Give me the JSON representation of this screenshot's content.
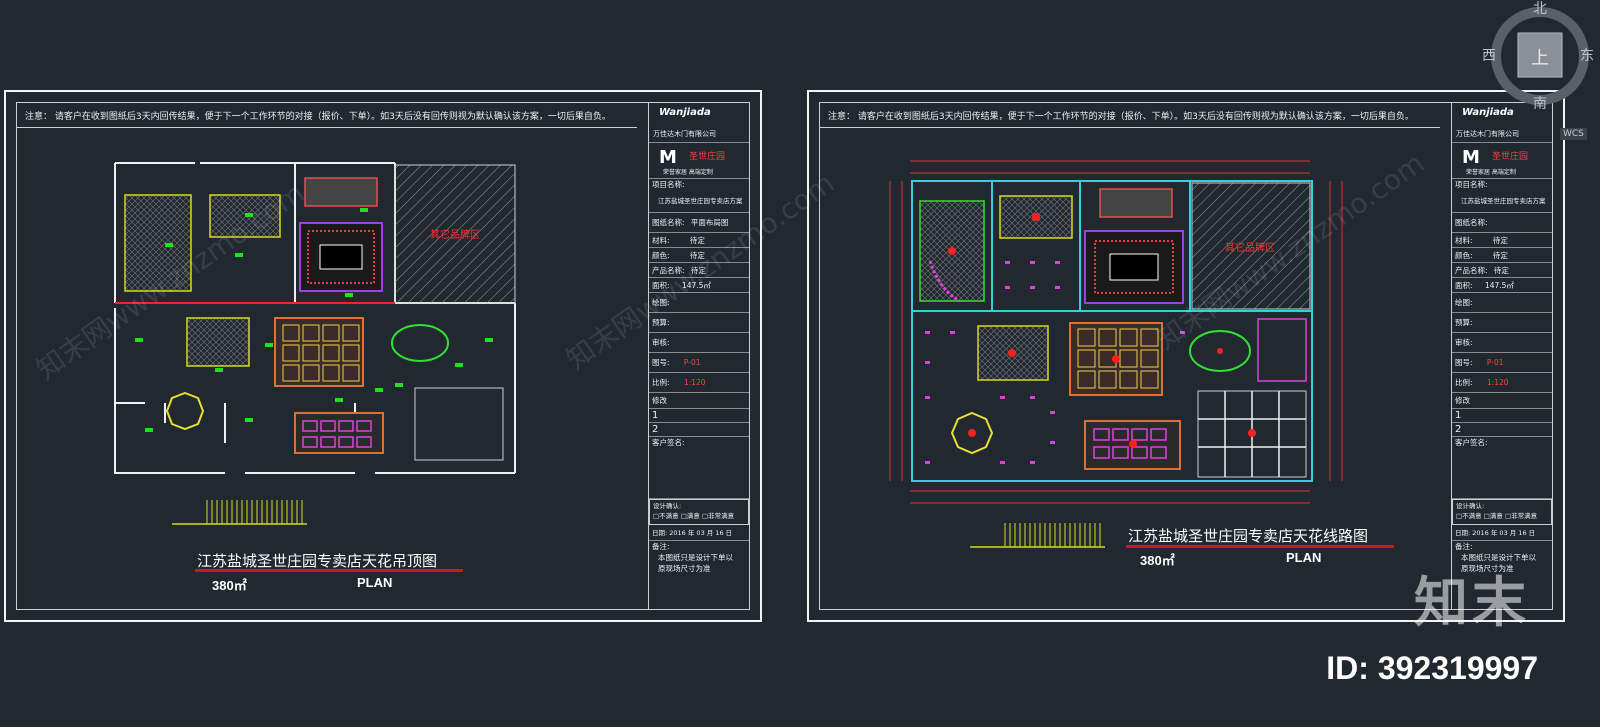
{
  "sheets": [
    {
      "note": "注意：  请客户在收到图纸后3天内回传结果，便于下一个工作环节的对接（报价、下单）。如3天后没有回传则视为默认确认该方案，一切后果自负。",
      "title": "江苏盐城圣世庄园专卖店天花吊顶图",
      "scale": "380㎡",
      "plan": "PLAN",
      "room_label": "其它品牌区",
      "titleblock": {
        "company": "万佳达木门有限公司",
        "brand_cn": "圣世庄园",
        "slogan": "荣誉家居  高端定制",
        "project_name_label": "项目名称:",
        "project_name": "江苏盐城圣世庄园专卖店方案",
        "drawing_name_label": "图纸名称:",
        "drawing_name": "平面布局图",
        "material_label": "材料:",
        "material": "待定",
        "color_label": "颜色:",
        "color": "待定",
        "product_label": "产品名称:",
        "product": "待定",
        "area_label": "面积:",
        "area": "147.5㎡",
        "draw_label": "绘图:",
        "budget_label": "预算:",
        "review_label": "审核:",
        "number_label": "图号:",
        "number": "P-01",
        "ratio_label": "比例:",
        "ratio": "1:120",
        "revise_label": "修改",
        "rev1": "1",
        "rev2": "2",
        "signature_label": "客户签名:",
        "design_conf_label": "设计确认:",
        "opt1": "□不满意",
        "opt2": "□满意",
        "opt3": "□非常满意",
        "date": "日期: 2016 年 03 月 16  日",
        "remark_label": "备注:",
        "remark": "本图纸只是设计下单以原现场尺寸为准"
      }
    },
    {
      "note": "注意：  请客户在收到图纸后3天内回传结果，便于下一个工作环节的对接（报价、下单）。如3天后没有回传则视为默认确认该方案，一切后果自负。",
      "title": "江苏盐城圣世庄园专卖店天花线路图",
      "scale": "380㎡",
      "plan": "PLAN",
      "room_label": "其它品牌区",
      "titleblock": {
        "company": "万佳达木门有限公司",
        "brand_cn": "圣世庄园",
        "slogan": "荣誉家居  高端定制",
        "project_name_label": "项目名称:",
        "project_name": "江苏盐城圣世庄园专卖店方案",
        "drawing_name_label": "图纸名称:",
        "drawing_name": "",
        "material_label": "材料:",
        "material": "待定",
        "color_label": "颜色:",
        "color": "待定",
        "product_label": "产品名称:",
        "product": "待定",
        "area_label": "面积:",
        "area": "147.5㎡",
        "draw_label": "绘图:",
        "budget_label": "预算:",
        "review_label": "审核:",
        "number_label": "图号:",
        "number": "P-01",
        "ratio_label": "比例:",
        "ratio": "1:120",
        "revise_label": "修改",
        "rev1": "1",
        "rev2": "2",
        "signature_label": "客户签名:",
        "design_conf_label": "设计确认:",
        "opt1": "□不满意",
        "opt2": "□满意",
        "opt3": "□非常满意",
        "date": "日期: 2016 年 03 月 16  日",
        "remark_label": "备注:",
        "remark": "本图纸只是设计下单以原现场尺寸为准"
      }
    }
  ],
  "compass": {
    "north": "北",
    "south": "南",
    "east": "东",
    "west": "西",
    "center": "上",
    "wcs": "WCS"
  },
  "watermark": {
    "brand": "知末",
    "id": "ID: 392319997",
    "site": "知末网www.znzmo.com"
  },
  "colors": {
    "background": "#212830",
    "red": "#d01818",
    "green": "#22dd22",
    "magenta": "#e040e0",
    "yellow": "#e8e030",
    "cyan": "#30d0e0"
  }
}
